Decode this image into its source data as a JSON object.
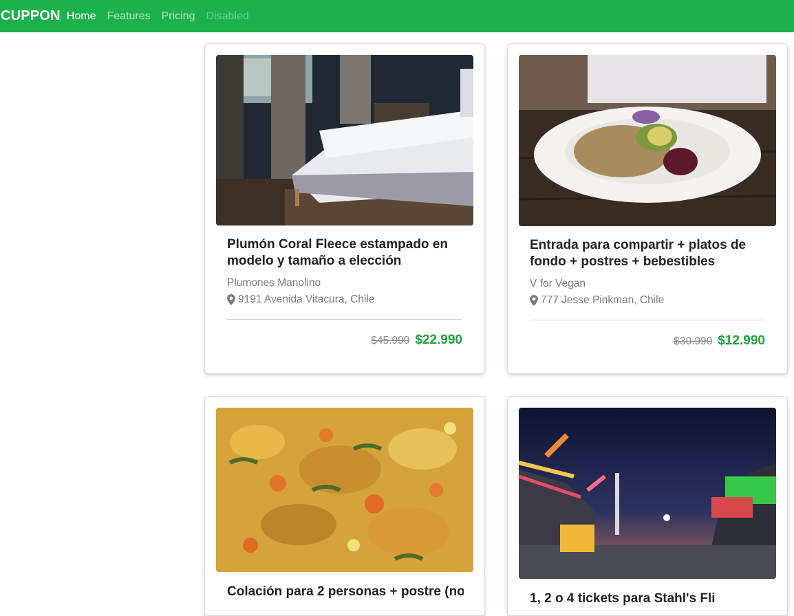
{
  "navbar": {
    "brand": "CUPPON",
    "links": [
      {
        "label": "Home"
      },
      {
        "label": "Features"
      },
      {
        "label": "Pricing"
      },
      {
        "label": "Disabled"
      }
    ],
    "color": "#1db14b"
  },
  "cards": [
    {
      "title": "Plumón Coral Fleece estampado en modelo y tamaño a elección",
      "merchant": "Plumones Manolino",
      "address": "9191 Avenida Vitacura, Chile",
      "old_price": "$45.990",
      "new_price": "$22.990",
      "image": "bedroom-photo"
    },
    {
      "title": "Entrada para compartir + platos de fondo + postres + bebestibles",
      "merchant": "V for Vegan",
      "address": "777 Jesse Pinkman, Chile",
      "old_price": "$30.990",
      "new_price": "$12.990",
      "image": "vegan-plate-photo"
    },
    {
      "title": "Colación para 2 personas + postre (no",
      "image": "stew-photo"
    },
    {
      "title": "1, 2 o 4 tickets para Stahl's Fli",
      "image": "fair-night-photo"
    }
  ],
  "icons": {
    "location": "map-marker-icon"
  },
  "colors": {
    "accent_price": "#1aa43a"
  }
}
